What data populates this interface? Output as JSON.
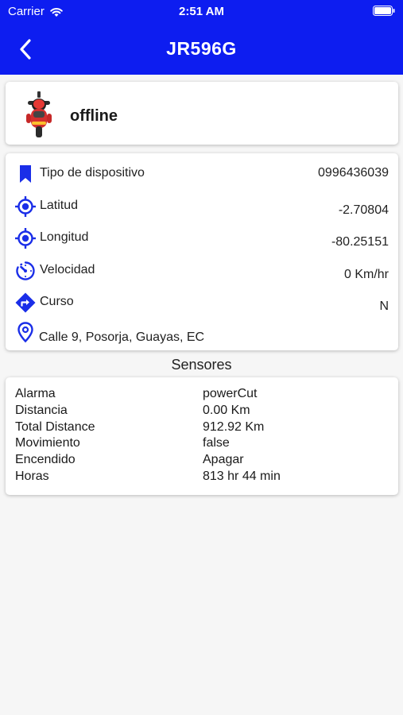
{
  "status_bar": {
    "carrier": "Carrier",
    "time": "2:51 AM"
  },
  "header": {
    "title": "JR596G",
    "background": "#0d1df0"
  },
  "device": {
    "status": "offline",
    "icon": "motorcycle-icon"
  },
  "info": {
    "accent": "#1a2ee8",
    "rows": [
      {
        "icon": "bookmark-icon",
        "label": "Tipo de dispositivo",
        "value": "0996436039"
      },
      {
        "icon": "crosshair-icon",
        "label": "Latitud",
        "value": "-2.70804"
      },
      {
        "icon": "crosshair-icon",
        "label": "Longitud",
        "value": "-80.25151"
      },
      {
        "icon": "speedometer-icon",
        "label": "Velocidad",
        "value": "0 Km/hr"
      },
      {
        "icon": "direction-icon",
        "label": "Curso",
        "value": "N"
      }
    ],
    "address_icon": "location-pin-icon",
    "address": "Calle 9, Posorja, Guayas, EC"
  },
  "sensors": {
    "title": "Sensores",
    "rows": [
      {
        "label": "Alarma",
        "value": "powerCut"
      },
      {
        "label": "Distancia",
        "value": "0.00 Km"
      },
      {
        "label": "Total Distance",
        "value": "912.92 Km"
      },
      {
        "label": "Movimiento",
        "value": "false"
      },
      {
        "label": "Encendido",
        "value": "Apagar"
      },
      {
        "label": "Horas",
        "value": "813 hr 44 min"
      }
    ]
  }
}
